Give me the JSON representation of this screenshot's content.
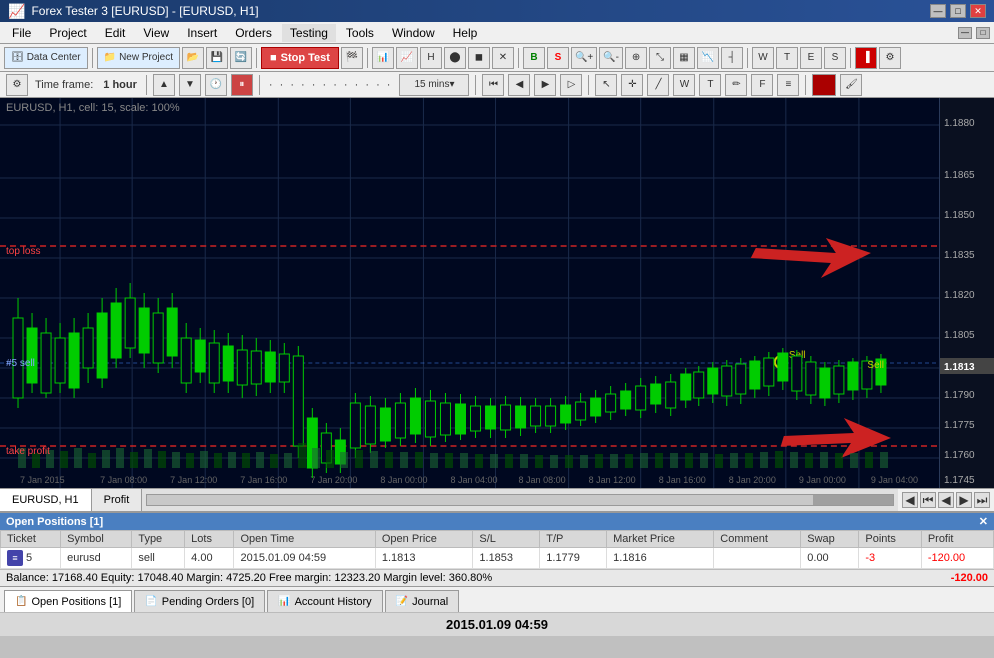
{
  "window": {
    "title": "Forex Tester 3 [EURUSD] - [EURUSD, H1]",
    "controls": [
      "—",
      "□",
      "✕"
    ]
  },
  "menu": {
    "items": [
      "File",
      "Project",
      "Edit",
      "View",
      "Insert",
      "Orders",
      "Testing",
      "Tools",
      "Window",
      "Help"
    ]
  },
  "toolbar1": {
    "data_center": "Data Center",
    "new_project": "New Project",
    "stop_test": "Stop Test"
  },
  "toolbar2": {
    "timeframe_label": "Time frame:",
    "timeframe_value": "1 hour",
    "period_value": "15 mins"
  },
  "chart": {
    "info": "EURUSD, H1, cell: 15, scale: 100%",
    "stop_loss_label": "top loss",
    "sell_label": "#5 sell",
    "take_profit_label": "take profit",
    "sell_marker": "Sell",
    "price_current": "1.1813",
    "price_high": "1.1880",
    "price_sl": "1.1850",
    "price_sell": "1.1813",
    "price_tp": "1.1775",
    "price_low": "1.1745",
    "dates": [
      "7 Jan 2015",
      "7 Jan 08:00",
      "7 Jan 12:00",
      "7 Jan 16:00",
      "7 Jan 20:00",
      "8 Jan 00:00",
      "8 Jan 04:00",
      "8 Jan 08:00",
      "8 Jan 12:00",
      "8 Jan 16:00",
      "8 Jan 20:00",
      "9 Jan 00:00",
      "9 Jan 04:00"
    ]
  },
  "chart_tab": {
    "symbol": "EURUSD, H1",
    "panel": "Profit"
  },
  "positions": {
    "header": "Open Positions [1]",
    "columns": [
      "Ticket",
      "Symbol",
      "Type",
      "Lots",
      "Open Time",
      "Open Price",
      "S/L",
      "T/P",
      "Market Price",
      "Comment",
      "Swap",
      "Points",
      "Profit"
    ],
    "rows": [
      {
        "ticket": "5",
        "symbol": "eurusd",
        "type": "sell",
        "lots": "4.00",
        "open_time": "2015.01.09 04:59",
        "open_price": "1.1813",
        "sl": "1.1853",
        "tp": "1.1779",
        "market_price": "1.1816",
        "comment": "",
        "swap": "0.00",
        "points": "-3",
        "profit": "-120.00"
      }
    ]
  },
  "balance_bar": {
    "text": "Balance: 17168.40  Equity: 17048.40  Margin: 4725.20  Free margin: 12323.20  Margin level: 360.80%",
    "profit": "-120.00"
  },
  "bottom_tabs": [
    {
      "label": "Open Positions [1]",
      "icon": "📋"
    },
    {
      "label": "Pending Orders [0]",
      "icon": "📄"
    },
    {
      "label": "Account History",
      "icon": "📊"
    },
    {
      "label": "Journal",
      "icon": "📝"
    }
  ],
  "datetime": {
    "value": "2015.01.09 04:59"
  }
}
